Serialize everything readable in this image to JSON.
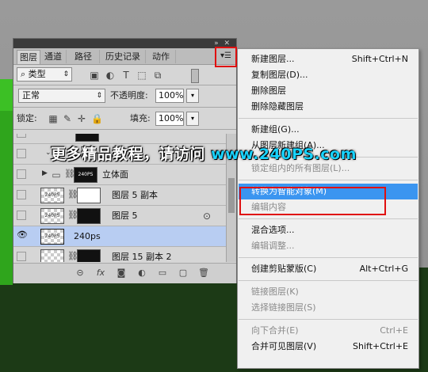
{
  "panel": {
    "tabs": [
      "图层",
      "通道",
      "路径",
      "历史记录",
      "动作"
    ],
    "active_tab": 0,
    "menu_button_icon": "panel-menu-icon",
    "window_controls": "»  ✕",
    "filter": {
      "label": "类型",
      "search_icon": "search-icon"
    },
    "blend_mode": "正常",
    "opacity_label": "不透明度:",
    "opacity_value": "100%",
    "lock_label": "锁定:",
    "fill_label": "填充:",
    "fill_value": "100%",
    "layers": [
      {
        "name": "",
        "partial": true
      },
      {
        "name": "",
        "group": true,
        "expanded": true
      },
      {
        "name": "立体面",
        "group": true,
        "thumb": "240PS",
        "mask": true
      },
      {
        "name": "图层 5 副本",
        "thumb": "240PS",
        "mask": true
      },
      {
        "name": "图层 5",
        "thumb": "240PS",
        "mask": true,
        "smart": true
      },
      {
        "name": "240ps",
        "thumb": "240PS",
        "selected": true,
        "visible": true
      },
      {
        "name": "图层 15 副本 2",
        "mask": true
      }
    ]
  },
  "watermark": {
    "text": "更多精品教程，请访问 ",
    "url": "www.240PS.com"
  },
  "context_menu": {
    "items": [
      {
        "label": "新建图层...",
        "shortcut": "Shift+Ctrl+N",
        "enabled": true
      },
      {
        "label": "复制图层(D)...",
        "shortcut": "",
        "enabled": true
      },
      {
        "label": "删除图层",
        "shortcut": "",
        "enabled": true
      },
      {
        "label": "删除隐藏图层",
        "shortcut": "",
        "enabled": true,
        "sep_after": true
      },
      {
        "label": "新建组(G)...",
        "shortcut": "",
        "enabled": true
      },
      {
        "label": "从图层新建组(A)...",
        "shortcut": "",
        "enabled": true,
        "sep_after": true
      },
      {
        "label": "锁定组内的所有图层(L)...",
        "shortcut": "",
        "enabled": false,
        "sep_after": true
      },
      {
        "label": "转换为智能对象(M)",
        "shortcut": "",
        "enabled": true,
        "highlighted": true
      },
      {
        "label": "编辑内容",
        "shortcut": "",
        "enabled": false,
        "sep_after": true
      },
      {
        "label": "混合选项...",
        "shortcut": "",
        "enabled": true
      },
      {
        "label": "编辑调整...",
        "shortcut": "",
        "enabled": false,
        "sep_after": true
      },
      {
        "label": "创建剪贴蒙版(C)",
        "shortcut": "Alt+Ctrl+G",
        "enabled": true,
        "sep_after": true
      },
      {
        "label": "链接图层(K)",
        "shortcut": "",
        "enabled": false
      },
      {
        "label": "选择链接图层(S)",
        "shortcut": "",
        "enabled": false,
        "sep_after": true
      },
      {
        "label": "向下合并(E)",
        "shortcut": "Ctrl+E",
        "enabled": false
      },
      {
        "label": "合并可见图层(V)",
        "shortcut": "Shift+Ctrl+E",
        "enabled": true
      }
    ]
  },
  "colors": {
    "highlight": "#3b95f0",
    "annotation_box": "#e01010",
    "selected_layer": "#b8cdf2"
  }
}
